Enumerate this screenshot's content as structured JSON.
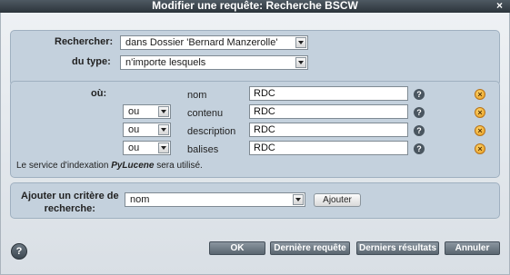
{
  "window": {
    "title": "Modifier une requête: Recherche BSCW",
    "close_glyph": "×"
  },
  "search": {
    "rechercher_label": "Rechercher:",
    "rechercher_value": "dans Dossier 'Bernard Manzerolle'",
    "type_label": "du type:",
    "type_value": "n'importe lesquels"
  },
  "criteria": {
    "ou_label": "où:",
    "rows": [
      {
        "connector": "",
        "field": "nom",
        "value": "RDC"
      },
      {
        "connector": "ou",
        "field": "contenu",
        "value": "RDC"
      },
      {
        "connector": "ou",
        "field": "description",
        "value": "RDC"
      },
      {
        "connector": "ou",
        "field": "balises",
        "value": "RDC"
      }
    ],
    "note_prefix": "Le service d'indexation ",
    "note_engine": "PyLucene",
    "note_suffix": " sera utilisé."
  },
  "add_criterion": {
    "label_line1": "Ajouter un critère de",
    "label_line2": "recherche:",
    "select_value": "nom",
    "button_label": "Ajouter"
  },
  "footer": {
    "help_glyph": "?",
    "ok_label": "OK",
    "last_query_label": "Dernière requête",
    "last_results_label": "Derniers résultats",
    "cancel_label": "Annuler"
  },
  "icons": {
    "help_glyph": "?",
    "remove_glyph": "×"
  }
}
